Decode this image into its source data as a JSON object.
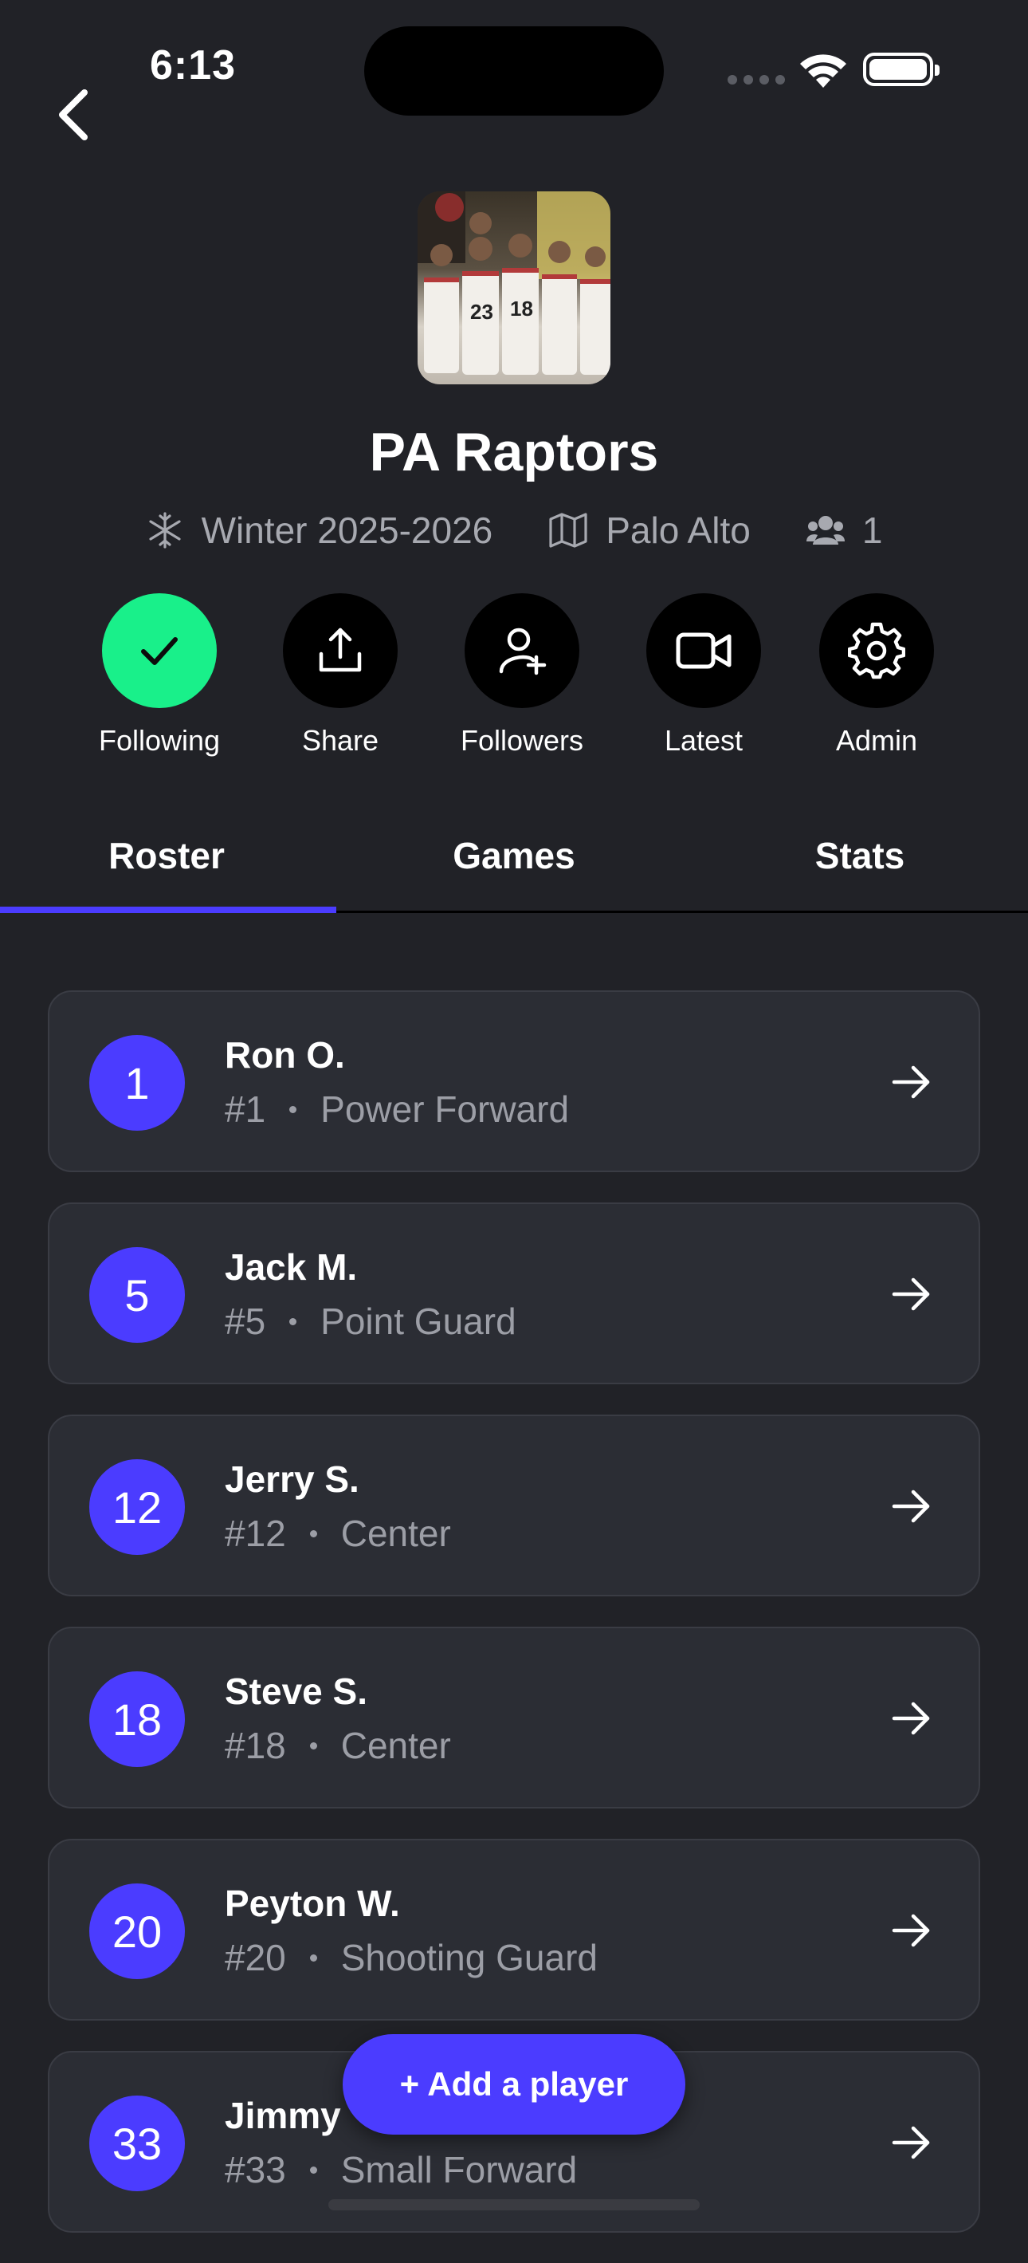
{
  "status_bar": {
    "time": "6:13"
  },
  "team": {
    "name": "PA Raptors",
    "season": "Winter 2025-2026",
    "location": "Palo Alto",
    "member_count": "1"
  },
  "actions": [
    {
      "label": "Following",
      "icon": "check-icon",
      "active": true
    },
    {
      "label": "Share",
      "icon": "share-icon"
    },
    {
      "label": "Followers",
      "icon": "add-user-icon"
    },
    {
      "label": "Latest",
      "icon": "video-icon"
    },
    {
      "label": "Admin",
      "icon": "gear-icon"
    }
  ],
  "tabs": [
    {
      "label": "Roster",
      "selected": true
    },
    {
      "label": "Games"
    },
    {
      "label": "Stats"
    }
  ],
  "roster": [
    {
      "number": "1",
      "name": "Ron O.",
      "jersey": "#1",
      "position": "Power Forward"
    },
    {
      "number": "5",
      "name": "Jack M.",
      "jersey": "#5",
      "position": "Point Guard"
    },
    {
      "number": "12",
      "name": "Jerry S.",
      "jersey": "#12",
      "position": "Center"
    },
    {
      "number": "18",
      "name": "Steve S.",
      "jersey": "#18",
      "position": "Center"
    },
    {
      "number": "20",
      "name": "Peyton W.",
      "jersey": "#20",
      "position": "Shooting Guard"
    },
    {
      "number": "33",
      "name": "Jimmy",
      "jersey": "#33",
      "position": "Small Forward"
    }
  ],
  "add_player_label": "+ Add a player",
  "colors": {
    "accent": "#4b3cff",
    "following": "#19f08a",
    "background": "#212227"
  }
}
